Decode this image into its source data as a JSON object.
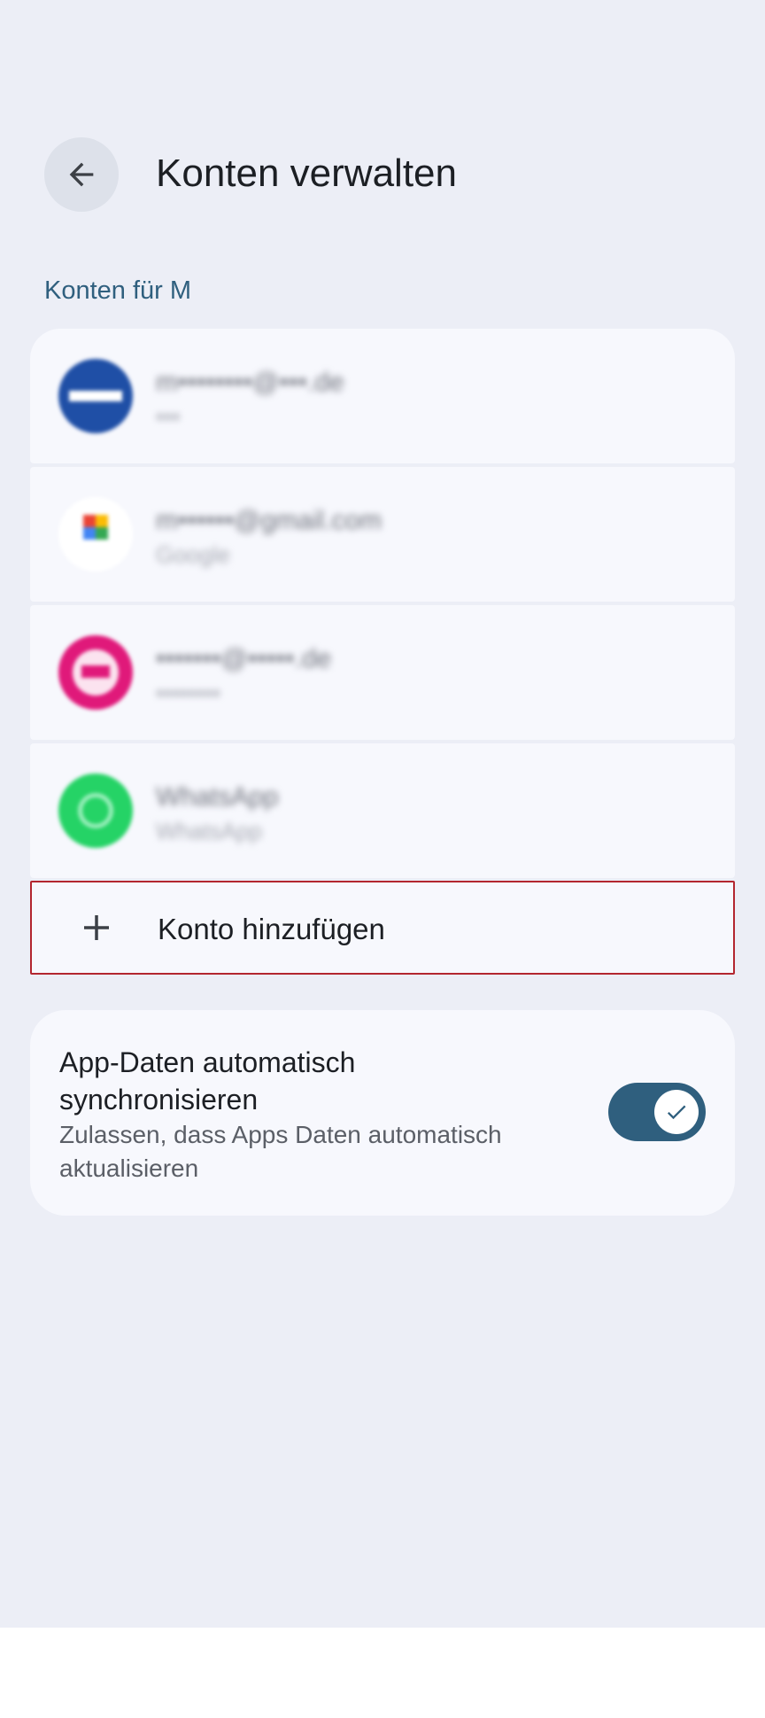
{
  "header": {
    "title": "Konten verwalten",
    "back_icon": "arrow-back-icon"
  },
  "section": {
    "label": "Konten für M"
  },
  "accounts": [
    {
      "account": "m••••••••@•••.de",
      "provider": "•••",
      "avatar_color": "#1f4fa6",
      "icon": "mail-provider-icon"
    },
    {
      "account": "m••••••@gmail.com",
      "provider": "Google",
      "avatar_color": "#ffffff",
      "icon": "google-icon"
    },
    {
      "account": "•••••••@•••••.de",
      "provider": "••••••••",
      "avatar_color": "#e0197a",
      "icon": "mail-provider-icon"
    },
    {
      "account": "WhatsApp",
      "provider": "WhatsApp",
      "avatar_color": "#25d366",
      "icon": "whatsapp-icon"
    }
  ],
  "add_account": {
    "label": "Konto hinzufügen",
    "icon": "plus-icon"
  },
  "sync": {
    "title": "App-Daten automatisch synchronisieren",
    "description": "Zulassen, dass Apps Daten automatisch aktualisieren",
    "enabled": true,
    "toggle_color": "#2f5f7e"
  }
}
